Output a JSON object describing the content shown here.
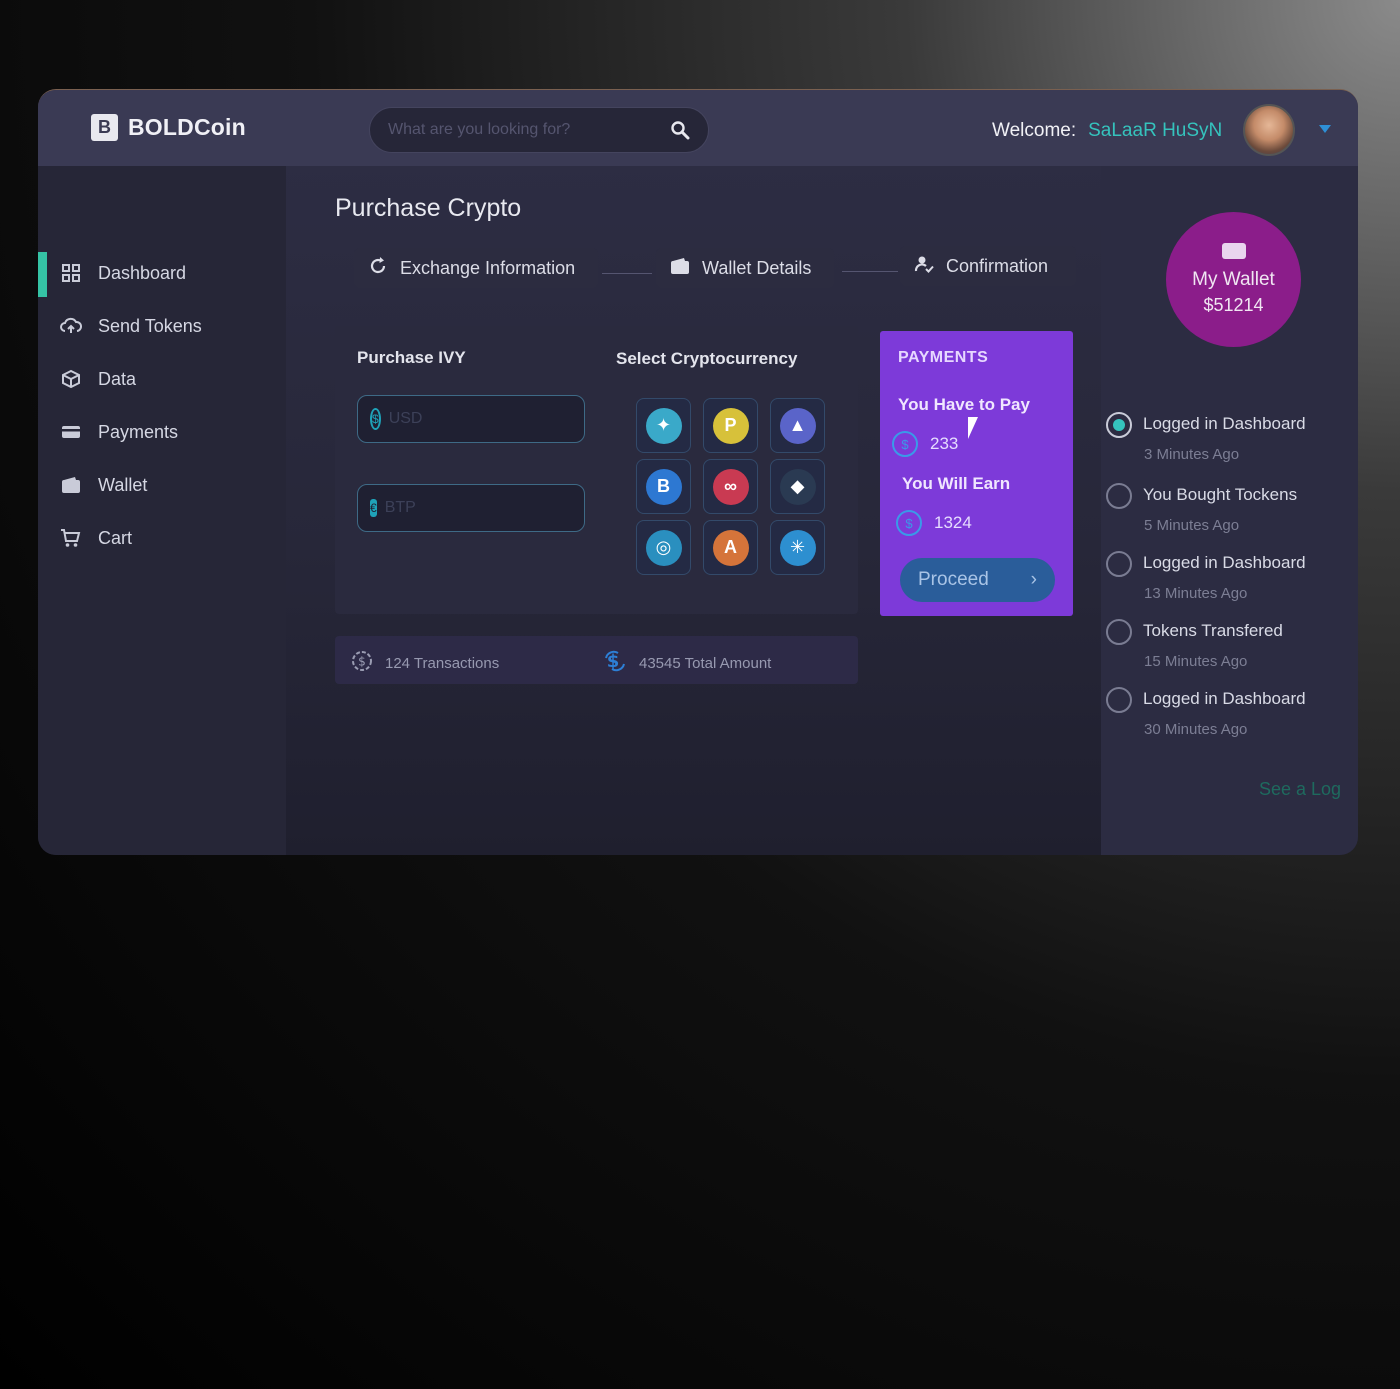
{
  "header": {
    "logo_letter": "B",
    "logo_text": "BOLDCoin",
    "search_placeholder": "What are you looking for?",
    "welcome_label": "Welcome:",
    "user_name": "SaLaaR HuSyN"
  },
  "sidebar": {
    "items": [
      {
        "label": "Dashboard",
        "icon": "grid-icon",
        "active": true
      },
      {
        "label": "Send Tokens",
        "icon": "cloud-upload-icon"
      },
      {
        "label": "Data",
        "icon": "cube-icon"
      },
      {
        "label": "Payments",
        "icon": "card-icon"
      },
      {
        "label": "Wallet",
        "icon": "wallet-icon"
      },
      {
        "label": "Cart",
        "icon": "cart-icon"
      }
    ]
  },
  "main": {
    "title": "Purchase Crypto",
    "steps": [
      {
        "label": "Exchange Information",
        "icon": "refresh-icon"
      },
      {
        "label": "Wallet Details",
        "icon": "wallet-icon"
      },
      {
        "label": "Confirmation",
        "icon": "user-check-icon"
      }
    ],
    "purchase": {
      "title": "Purchase IVY",
      "usd_placeholder": "USD",
      "btp_placeholder": "BTP"
    },
    "select": {
      "title": "Select Cryptocurrency",
      "coins": [
        {
          "name": "coin-1",
          "color": "#3aa9c9",
          "glyph": "✦"
        },
        {
          "name": "coin-2",
          "color": "#d7c13a",
          "glyph": "P"
        },
        {
          "name": "coin-3",
          "color": "#5a64c9",
          "glyph": "▲"
        },
        {
          "name": "coin-4",
          "color": "#2d78d2",
          "glyph": "B"
        },
        {
          "name": "coin-5",
          "color": "#c93a52",
          "glyph": "∞"
        },
        {
          "name": "coin-6",
          "color": "#2a3a52",
          "glyph": "◆"
        },
        {
          "name": "coin-7",
          "color": "#2a8fbf",
          "glyph": "◎"
        },
        {
          "name": "coin-8",
          "color": "#d5743a",
          "glyph": "A"
        },
        {
          "name": "coin-9",
          "color": "#2d8fd0",
          "glyph": "✳"
        }
      ]
    },
    "payments": {
      "heading": "PAYMENTS",
      "pay_label": "You Have to Pay",
      "pay_value": "233",
      "earn_label": "You Will Earn",
      "earn_value": "1324",
      "proceed_label": "Proceed",
      "proceed_arrow": "›"
    },
    "stats": {
      "transactions": "124 Transactions",
      "total": "43545 Total Amount"
    }
  },
  "wallet": {
    "label": "My Wallet",
    "value": "$51214"
  },
  "activity": [
    {
      "title": "Logged in Dashboard",
      "time": "3 Minutes Ago",
      "selected": true
    },
    {
      "title": "You Bought Tockens",
      "time": "5 Minutes Ago"
    },
    {
      "title": "Logged in Dashboard",
      "time": "13 Minutes Ago"
    },
    {
      "title": "Tokens Transfered",
      "time": "15 Minutes Ago"
    },
    {
      "title": "Logged in Dashboard",
      "time": "30 Minutes Ago"
    }
  ],
  "see_log_label": "See a Log",
  "colors": {
    "accent": "#35c3bd",
    "payments_bg": "#7d3ad9",
    "wallet_bg": "#8b1d8a",
    "active_bar": "#35c3a5"
  }
}
